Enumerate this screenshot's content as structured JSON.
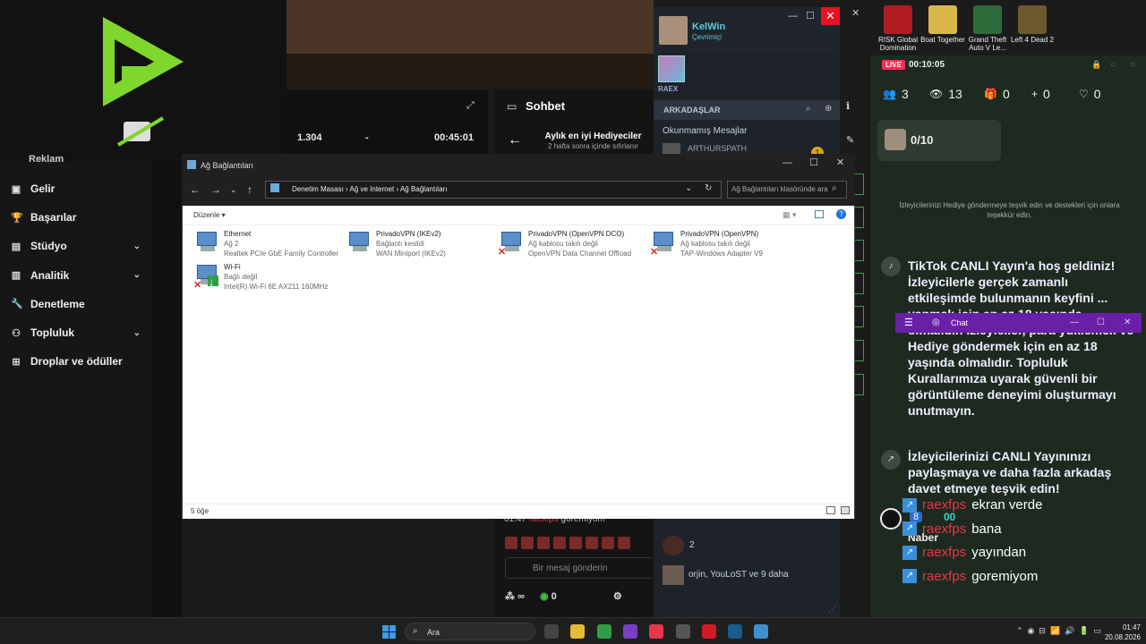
{
  "studio": {
    "stats": [
      "1.304",
      "-",
      "00:45:01"
    ],
    "sohbet_title": "Sohbet",
    "gift_title": "Aylık en iyi Hediyeciler",
    "gift_sub": "2 hafta sonra içinde sıfırlanır",
    "sidebar": [
      {
        "icon": "wallet-icon",
        "label": "Gelir",
        "chevron": false
      },
      {
        "icon": "trophy-icon",
        "label": "Başarılar",
        "chevron": false
      },
      {
        "icon": "studio-icon",
        "label": "Stüdyo",
        "chevron": true
      },
      {
        "icon": "analytics-icon",
        "label": "Analitik",
        "chevron": true
      },
      {
        "icon": "wrench-icon",
        "label": "Denetleme",
        "chevron": false
      },
      {
        "icon": "community-icon",
        "label": "Topluluk",
        "chevron": true
      },
      {
        "icon": "gift-icon",
        "label": "Droplar ve ödüller",
        "chevron": false
      }
    ],
    "reklam": "Reklam",
    "chat_line": "01:47",
    "chat_line_text": "goremiyom",
    "message_placeholder": "Bir mesaj gönderin",
    "bottom_counts": [
      "∞",
      "0"
    ]
  },
  "friends": {
    "name": "KelWin",
    "status": "Çevrimiçi",
    "game_tag": "RAEX",
    "section": "ARKADAŞLAR",
    "unread": "Okunmamış Mesajlar",
    "unread_user": "ARTHURSPATH",
    "badge": "1",
    "row_count": "2",
    "row_group": "orjin, YouLoST ve 9 daha"
  },
  "explorer": {
    "title": "Ağ Bağlantıları",
    "breadcrumb": "Denetim Masası  ›  Ağ ve Internet  ›  Ağ Bağlantıları",
    "search_placeholder": "Ağ Bağlantıları klasöründe ara",
    "command": "Düzenle ▾",
    "status": "5 öğe",
    "connections": [
      {
        "name": "Ethernet",
        "status": "Ağ 2",
        "adapter": "Realtek PCIe GbE Family Controller",
        "disabled": false,
        "wifi": false
      },
      {
        "name": "PrivadoVPN (IKEv2)",
        "status": "Bağlantı kesildi",
        "adapter": "WAN Miniport (IKEv2)",
        "disabled": false,
        "wifi": false
      },
      {
        "name": "PrivadoVPN (OpenVPN DCO)",
        "status": "Ağ kablosu takılı değil",
        "adapter": "OpenVPN Data Channel Offload",
        "disabled": true,
        "wifi": false
      },
      {
        "name": "PrivadoVPN (OpenVPN)",
        "status": "Ağ kablosu takılı değil",
        "adapter": "TAP-Windows Adapter V9",
        "disabled": true,
        "wifi": false
      },
      {
        "name": "Wi-Fi",
        "status": "Bağlı değil",
        "adapter": "Intel(R) Wi-Fi 6E AX211 160MHz",
        "disabled": true,
        "wifi": true
      }
    ]
  },
  "tiktok": {
    "games": [
      {
        "label": "RISK Global Domination",
        "color": "#b01c22"
      },
      {
        "label": "Boat Together",
        "color": "#d9b84a"
      },
      {
        "label": "Grand Theft Auto V Le...",
        "color": "#2d6b3a"
      },
      {
        "label": "Left 4 Dead 2",
        "color": "#6b5a2c"
      }
    ],
    "live": "LIVE",
    "time": "00:10:05",
    "stats": [
      {
        "icon": "people-icon",
        "glyph": "👥",
        "value": "3"
      },
      {
        "icon": "eye-icon",
        "glyph": "👁",
        "value": "13"
      },
      {
        "icon": "gift-icon",
        "glyph": "🎁",
        "value": "0"
      },
      {
        "icon": "follow-icon",
        "glyph": "+",
        "value": "0"
      },
      {
        "icon": "heart-icon",
        "glyph": "♡",
        "value": "0"
      }
    ],
    "goal": "0/10",
    "encourage": "İzleyicilerinizi Hediye göndermeye teşvik edin ve destekleri için onlara teşekkür edin.",
    "welcome": "TikTok CANLI Yayın'a hoş geldiniz! İzleyicilerle gerçek zamanlı etkileşimde bulunmanın keyfini ... yapmak için en az 18 yaşında olmalıdır. İzleyiciler, para yüklemek ve Hediye göndermek için en az 18 yaşında olmalıdır. Topluluk Kurallarımıza uyarak güvenli bir görüntüleme deneyimi oluşturmayı unutmayın.",
    "share": "İzleyicilerinizi CANLI Yayınınızı paylaşmaya ve daha fazla arkadaş davet etmeye teşvik edin!",
    "chat_popup_title": "Chat",
    "count_8": "8",
    "count_00": "00",
    "naber": "Naber",
    "chat": [
      {
        "user": "raexfps",
        "text": "ekran verde"
      },
      {
        "user": "raexfps",
        "text": "bana"
      },
      {
        "user": "raexfps",
        "text": "yayından"
      },
      {
        "user": "raexfps",
        "text": "goremiyom"
      }
    ]
  },
  "taskbar": {
    "search": "Ara",
    "time": "01:47",
    "date": "20.08.2026",
    "icons": [
      {
        "name": "task-view-icon",
        "color": "#444"
      },
      {
        "name": "file-explorer-icon",
        "color": "#e8b93a"
      },
      {
        "name": "chrome-icon",
        "color": "#2f9e44"
      },
      {
        "name": "app-purple-icon",
        "color": "#7b3fc4"
      },
      {
        "name": "tiktok-icon",
        "color": "#e2384a"
      },
      {
        "name": "obs-icon",
        "color": "#555"
      },
      {
        "name": "opera-icon",
        "color": "#d01b25"
      },
      {
        "name": "steam-icon",
        "color": "#1b5c8f"
      },
      {
        "name": "network-icon",
        "color": "#3d8fcf"
      }
    ]
  }
}
